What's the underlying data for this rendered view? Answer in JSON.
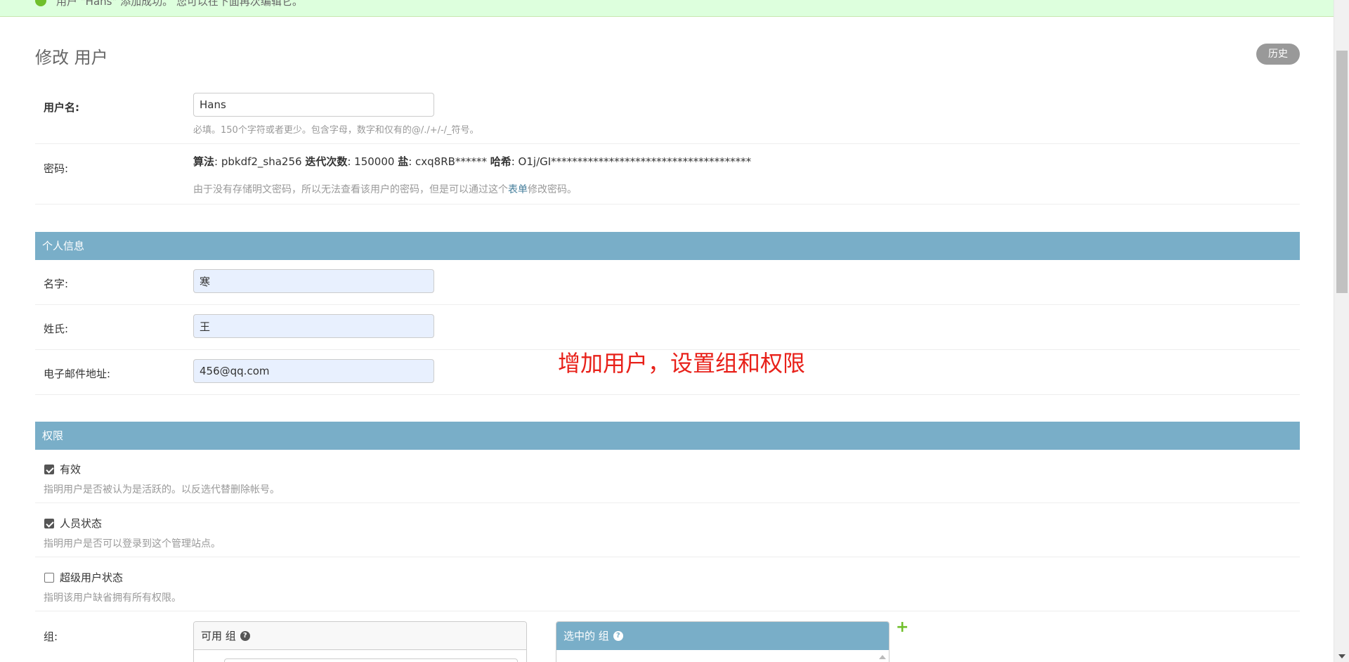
{
  "message": {
    "text": "用户 \"Hans\" 添加成功。 您可以在下面再次编辑它。"
  },
  "page": {
    "title": "修改 用户",
    "history_label": "历史"
  },
  "username": {
    "label": "用户名:",
    "value": "Hans",
    "help": "必填。150个字符或者更少。包含字母，数字和仅有的@/./+/-/_符号。"
  },
  "password": {
    "label": "密码:",
    "algorithm_label": "算法",
    "algorithm_value": ": pbkdf2_sha256 ",
    "iterations_label": "迭代次数",
    "iterations_value": ": 150000 ",
    "salt_label": "盐",
    "salt_value": ": cxq8RB****** ",
    "hash_label": "哈希",
    "hash_value": ": O1j/GI**************************************",
    "help_before": "由于没有存储明文密码，所以无法查看该用户的密码，但是可以通过这个",
    "help_link": "表单",
    "help_after": "修改密码。"
  },
  "personal": {
    "header": "个人信息",
    "first_name": {
      "label": "名字:",
      "value": "寒"
    },
    "last_name": {
      "label": "姓氏:",
      "value": "王"
    },
    "email": {
      "label": "电子邮件地址:",
      "value": "456@qq.com"
    }
  },
  "annotation": "增加用户，设置组和权限",
  "permissions": {
    "header": "权限",
    "is_active": {
      "label": "有效",
      "checked": true,
      "help": "指明用户是否被认为是活跃的。以反选代替删除帐号。"
    },
    "is_staff": {
      "label": "人员状态",
      "checked": true,
      "help": "指明用户是否可以登录到这个管理站点。"
    },
    "is_superuser": {
      "label": "超级用户状态",
      "checked": false,
      "help": "指明该用户缺省拥有所有权限。"
    },
    "groups_label": "组:",
    "available_title": "可用 组",
    "chosen_title": "选中的 组",
    "add_icon": "plus-icon"
  },
  "colors": {
    "section": "#79aec8",
    "annotation": "#e8211a",
    "success": "#70bf2b"
  }
}
